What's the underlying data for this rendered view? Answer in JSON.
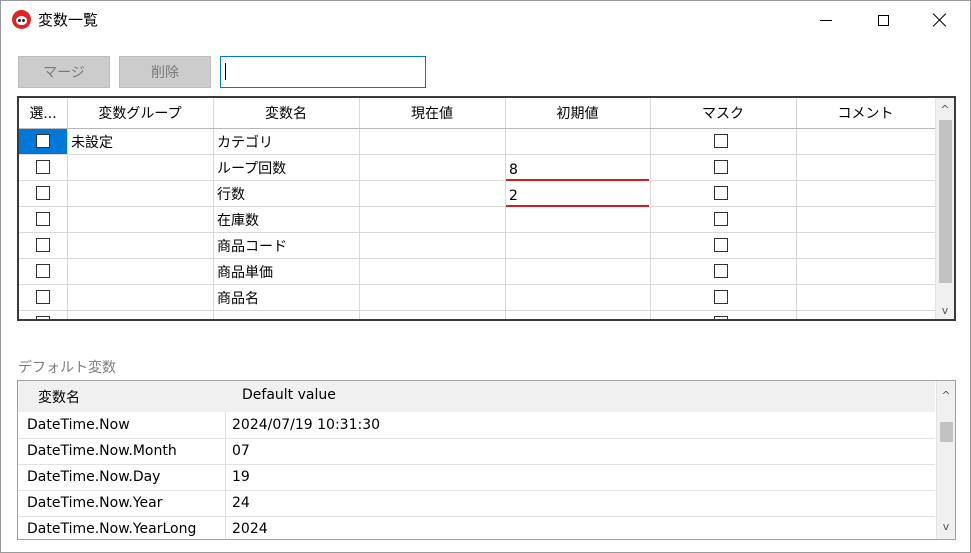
{
  "window": {
    "title": "変数一覧"
  },
  "toolbar": {
    "merge_label": "マージ",
    "delete_label": "削除",
    "search_value": ""
  },
  "variables_table": {
    "columns": [
      "選...",
      "変数グループ",
      "変数名",
      "現在値",
      "初期値",
      "マスク",
      "コメント"
    ],
    "rows": [
      {
        "group": "未設定",
        "name": "カテゴリ",
        "current": "",
        "initial": "",
        "comment": ""
      },
      {
        "group": "",
        "name": "ループ回数",
        "current": "",
        "initial": "8",
        "comment": ""
      },
      {
        "group": "",
        "name": "行数",
        "current": "",
        "initial": "2",
        "comment": ""
      },
      {
        "group": "",
        "name": "在庫数",
        "current": "",
        "initial": "",
        "comment": ""
      },
      {
        "group": "",
        "name": "商品コード",
        "current": "",
        "initial": "",
        "comment": ""
      },
      {
        "group": "",
        "name": "商品単価",
        "current": "",
        "initial": "",
        "comment": ""
      },
      {
        "group": "",
        "name": "商品名",
        "current": "",
        "initial": "",
        "comment": ""
      }
    ]
  },
  "default_variables": {
    "label": "デフォルト変数",
    "columns": [
      "変数名",
      "Default value"
    ],
    "rows": [
      {
        "name": "DateTime.Now",
        "value": "2024/07/19 10:31:30"
      },
      {
        "name": "DateTime.Now.Month",
        "value": "07"
      },
      {
        "name": "DateTime.Now.Day",
        "value": "19"
      },
      {
        "name": "DateTime.Now.Year",
        "value": "24"
      },
      {
        "name": "DateTime.Now.YearLong",
        "value": "2024"
      }
    ]
  },
  "scroll": {
    "up_glyph": "^",
    "down_glyph": "v"
  },
  "colors": {
    "selection": "#0078d7",
    "error_underline": "#d11e1e",
    "button_bg": "#cccccc"
  }
}
